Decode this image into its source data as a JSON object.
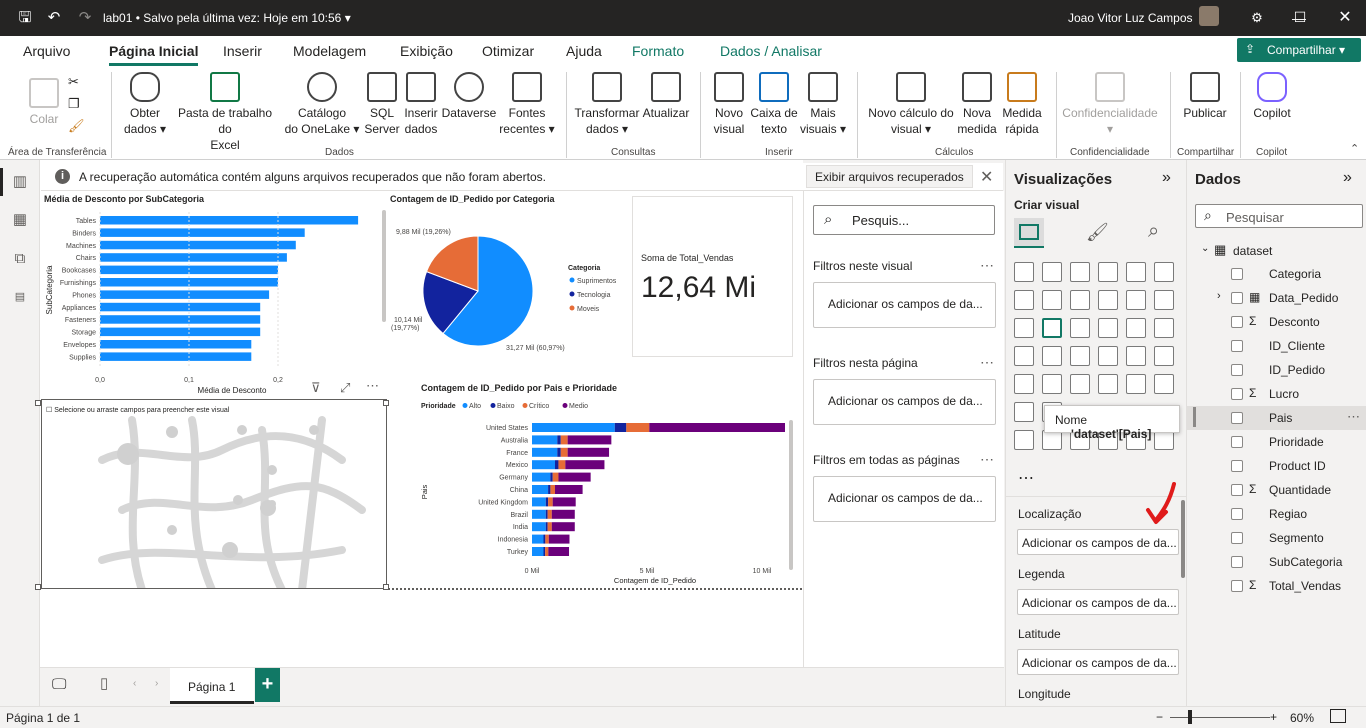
{
  "titlebar": {
    "file_name": "lab01",
    "saved_status": "• Salvo pela última vez: Hoje em 10:56",
    "user_name": "Joao Vitor Luz Campos"
  },
  "menu": {
    "tabs": [
      "Arquivo",
      "Página Inicial",
      "Inserir",
      "Modelagem",
      "Exibição",
      "Otimizar",
      "Ajuda",
      "Formato",
      "Dados / Analisar"
    ],
    "share_label": "Compartilhar"
  },
  "ribbon": {
    "clipboard": {
      "paste": "Colar",
      "group": "Área de Transferência"
    },
    "data": {
      "get_data": [
        "Obter",
        "dados"
      ],
      "excel": [
        "Pasta de trabalho do",
        "Excel"
      ],
      "onelake": [
        "Catálogo",
        "do OneLake"
      ],
      "sql": [
        "SQL",
        "Server"
      ],
      "insert": [
        "Inserir",
        "dados"
      ],
      "dataverse": "Dataverse",
      "recent": [
        "Fontes",
        "recentes"
      ],
      "group": "Dados"
    },
    "queries": {
      "transform": [
        "Transformar",
        "dados"
      ],
      "refresh": "Atualizar",
      "group": "Consultas"
    },
    "insert": {
      "new_visual": [
        "Novo",
        "visual"
      ],
      "textbox": [
        "Caixa de",
        "texto"
      ],
      "more": [
        "Mais",
        "visuais"
      ],
      "group": "Inserir"
    },
    "calc": {
      "new_calc": [
        "Novo cálculo do",
        "visual"
      ],
      "new_measure": [
        "Nova",
        "medida"
      ],
      "quick_measure": [
        "Medida",
        "rápida"
      ],
      "group": "Cálculos"
    },
    "sensitivity": {
      "label": "Confidencialidade",
      "group": "Confidencialidade"
    },
    "share": {
      "publish": "Publicar",
      "group": "Compartilhar"
    },
    "copilot": {
      "label": "Copilot",
      "group": "Copilot"
    }
  },
  "infobar": {
    "message": "A recuperação automática contém alguns arquivos recuperados que não foram abertos.",
    "button": "Exibir arquivos recuperados"
  },
  "visuals": {
    "bar": {
      "title": "Média de Desconto por SubCategoria",
      "ylabel": "SubCategoria",
      "xlabel": "Média de Desconto",
      "ticks": [
        "0,0",
        "0,1",
        "0,2"
      ]
    },
    "pie": {
      "title": "Contagem de ID_Pedido por Categoria",
      "legend_title": "Categoria",
      "labels": [
        "9,88 Mil (19,26%)",
        "10,14 Mil (19,77%)",
        "31,27 Mil (60,97%)"
      ]
    },
    "card": {
      "value": "12,64 Mi",
      "label": "Soma de Total_Vendas"
    },
    "map": {
      "placeholder": "Selecione ou arraste campos para preencher este visual"
    },
    "stacked": {
      "title": "Contagem de ID_Pedido por Pais e Prioridade",
      "legend_title": "Prioridade",
      "ylabel": "Pais",
      "xlabel": "Contagem de ID_Pedido",
      "ticks": [
        "0 Mil",
        "5 Mil",
        "10 Mil"
      ]
    }
  },
  "chart_data": [
    {
      "type": "bar",
      "title": "Média de Desconto por SubCategoria",
      "categories": [
        "Tables",
        "Binders",
        "Machines",
        "Chairs",
        "Bookcases",
        "Furnishings",
        "Phones",
        "Appliances",
        "Fasteners",
        "Storage",
        "Envelopes",
        "Supplies"
      ],
      "values": [
        0.29,
        0.23,
        0.22,
        0.21,
        0.2,
        0.2,
        0.19,
        0.18,
        0.18,
        0.18,
        0.17,
        0.17
      ],
      "xlabel": "Média de Desconto",
      "ylabel": "SubCategoria",
      "xlim": [
        0,
        0.3
      ]
    },
    {
      "type": "pie",
      "title": "Contagem de ID_Pedido por Categoria",
      "series": [
        {
          "name": "Suprimentos",
          "value": 31.27,
          "color": "#118dff"
        },
        {
          "name": "Tecnologia",
          "value": 10.14,
          "color": "#12239e"
        },
        {
          "name": "Moveis",
          "value": 9.88,
          "color": "#e66c37"
        }
      ]
    },
    {
      "type": "bar",
      "title": "Contagem de ID_Pedido por Pais e Prioridade",
      "categories": [
        "United States",
        "Australia",
        "France",
        "Mexico",
        "Germany",
        "China",
        "United Kingdom",
        "Brazil",
        "India",
        "Indonesia",
        "Turkey"
      ],
      "series": [
        {
          "name": "Alto",
          "color": "#118dff",
          "values": [
            3.6,
            1.1,
            1.1,
            1.0,
            0.8,
            0.7,
            0.6,
            0.6,
            0.6,
            0.5,
            0.5
          ]
        },
        {
          "name": "Baixo",
          "color": "#12239e",
          "values": [
            0.5,
            0.15,
            0.15,
            0.15,
            0.1,
            0.1,
            0.1,
            0.08,
            0.08,
            0.08,
            0.07
          ]
        },
        {
          "name": "Crítico",
          "color": "#e66c37",
          "values": [
            1.0,
            0.3,
            0.3,
            0.3,
            0.25,
            0.2,
            0.2,
            0.18,
            0.18,
            0.15,
            0.14
          ]
        },
        {
          "name": "Medio",
          "color": "#6b007b",
          "values": [
            5.9,
            1.9,
            1.8,
            1.7,
            1.4,
            1.2,
            1.0,
            1.0,
            1.0,
            0.9,
            0.9
          ]
        }
      ],
      "xlabel": "Contagem de ID_Pedido",
      "ylabel": "Pais",
      "xlim": [
        0,
        11
      ]
    }
  ],
  "filters": {
    "search": "Pesquis...",
    "visual": "Filtros neste visual",
    "page": "Filtros nesta página",
    "all": "Filtros em todas as páginas",
    "add": "Adicionar os campos de da..."
  },
  "viz_pane": {
    "title": "Visualizações",
    "build": "Criar visual",
    "wells": [
      "Localização",
      "Legenda",
      "Latitude",
      "Longitude"
    ],
    "add": "Adicionar os campos de da...",
    "tooltip_name": "Nome",
    "tooltip_value": "'dataset'[Pais]"
  },
  "data_pane": {
    "title": "Dados",
    "search": "Pesquisar",
    "table": "dataset",
    "fields": [
      {
        "name": "Categoria",
        "sigma": false
      },
      {
        "name": "Data_Pedido",
        "sigma": false
      },
      {
        "name": "Desconto",
        "sigma": true
      },
      {
        "name": "ID_Cliente",
        "sigma": false
      },
      {
        "name": "ID_Pedido",
        "sigma": false
      },
      {
        "name": "Lucro",
        "sigma": true
      },
      {
        "name": "Pais",
        "sigma": false
      },
      {
        "name": "Prioridade",
        "sigma": false
      },
      {
        "name": "Product ID",
        "sigma": false
      },
      {
        "name": "Quantidade",
        "sigma": true
      },
      {
        "name": "Regiao",
        "sigma": false
      },
      {
        "name": "Segmento",
        "sigma": false
      },
      {
        "name": "SubCategoria",
        "sigma": false
      },
      {
        "name": "Total_Vendas",
        "sigma": true
      }
    ]
  },
  "pages": {
    "tab": "Página 1"
  },
  "status": {
    "page": "Página 1 de 1",
    "zoom": "60%"
  }
}
